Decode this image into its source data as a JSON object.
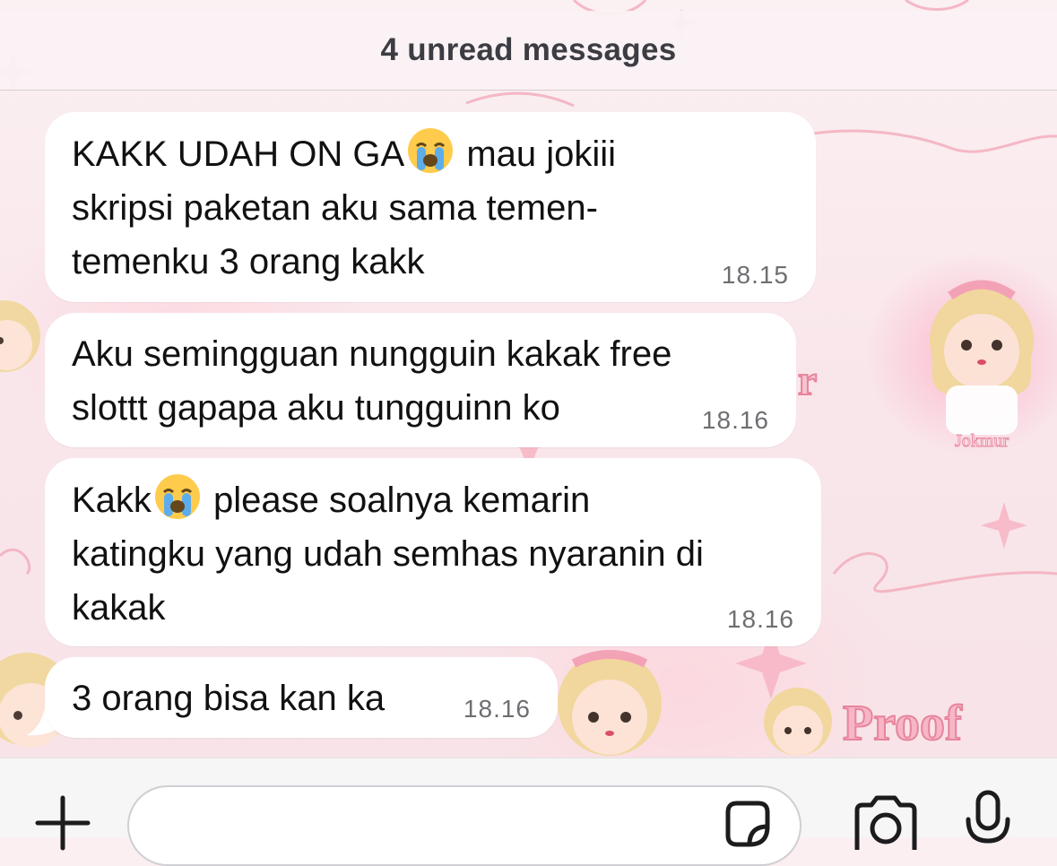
{
  "banner": {
    "text": "4 unread messages"
  },
  "messages": [
    {
      "lines": [
        "KAKK UDAH ON GA",
        " mau jokiii\nskripsi paketan aku sama temen-\ntemenku 3 orang kakk"
      ],
      "time": "18.15"
    },
    {
      "text": "Aku semingguan nungguin kakak free\nslottt gapapa aku tungguinn ko",
      "time": "18.16"
    },
    {
      "lines": [
        "Kakk",
        " please soalnya kemarin\nkatingku yang udah semhas nyaranin di\nkakak"
      ],
      "time": "18.16"
    },
    {
      "text": "3 orang bisa kan ka",
      "time": "18.16"
    }
  ],
  "emoji": {
    "name": "loudly-crying-face-icon"
  },
  "wallpaper": {
    "stickers": [
      "Proof",
      "Jokmur",
      "Proof"
    ]
  },
  "input_bar": {
    "placeholder": "",
    "icons": [
      "plus-icon",
      "sticker-icon",
      "camera-icon",
      "microphone-icon"
    ]
  },
  "colors": {
    "bubble": "#ffffff",
    "wallpaper_pink": "#f9e6ea",
    "accent_pink": "#ef8aa6",
    "timestamp": "#6e6e73"
  }
}
